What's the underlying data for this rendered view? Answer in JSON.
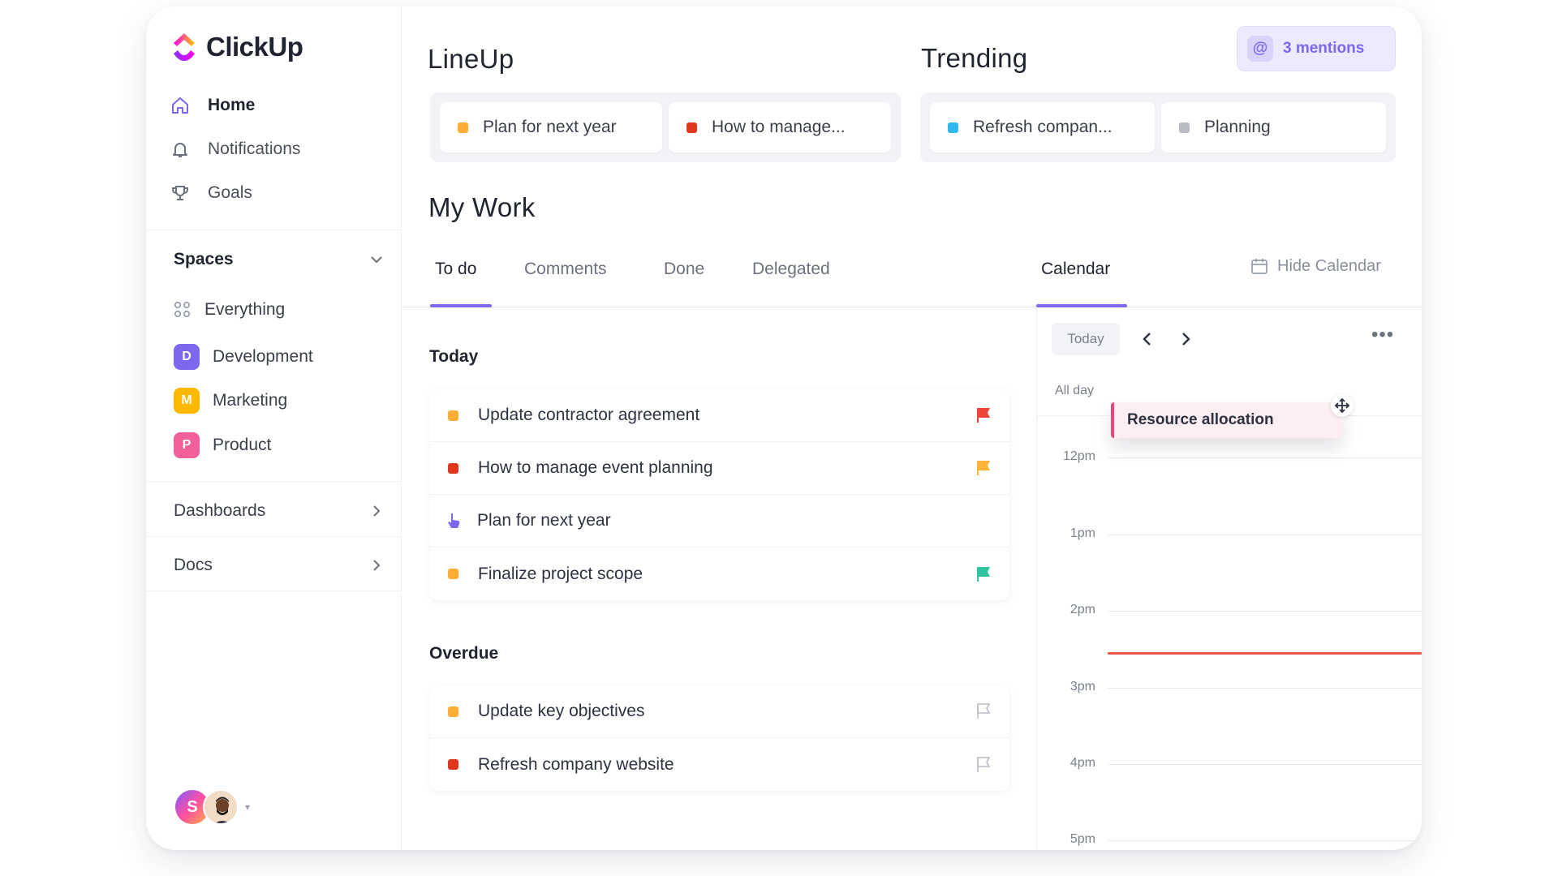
{
  "brand": {
    "name": "ClickUp"
  },
  "sidebar": {
    "nav": [
      {
        "label": "Home",
        "icon": "home-icon"
      },
      {
        "label": "Notifications",
        "icon": "bell-icon"
      },
      {
        "label": "Goals",
        "icon": "trophy-icon"
      }
    ],
    "spaces_title": "Spaces",
    "everything_label": "Everything",
    "spaces": [
      {
        "letter": "D",
        "label": "Development",
        "color": "#7b68ee"
      },
      {
        "letter": "M",
        "label": "Marketing",
        "color": "#ffb800"
      },
      {
        "letter": "P",
        "label": "Product",
        "color": "#f25f9a"
      }
    ],
    "dashboards_label": "Dashboards",
    "docs_label": "Docs",
    "avatar_letter": "S"
  },
  "lineup": {
    "title": "LineUp",
    "items": [
      {
        "label": "Plan for next year",
        "color": "#ffae35"
      },
      {
        "label": "How to manage...",
        "color": "#e0371f"
      }
    ]
  },
  "trending": {
    "title": "Trending",
    "items": [
      {
        "label": "Refresh compan...",
        "color": "#2eb9f0"
      },
      {
        "label": "Planning",
        "color": "#b9bcc3"
      }
    ]
  },
  "mentions": {
    "label": "3 mentions"
  },
  "my_work": {
    "title": "My Work",
    "tabs": [
      "To do",
      "Comments",
      "Done",
      "Delegated"
    ],
    "calendar_tab": "Calendar",
    "hide_calendar": "Hide Calendar",
    "today_label": "Today",
    "today_tasks": [
      {
        "title": "Update contractor agreement",
        "color": "#ffae35",
        "flag": "#f0453a"
      },
      {
        "title": "How to manage event planning",
        "color": "#e0371f",
        "flag": "#ffb33a"
      },
      {
        "title": "Plan for next year",
        "color": "#7b68ee",
        "flag": ""
      },
      {
        "title": "Finalize project scope",
        "color": "#ffae35",
        "flag": "#2ec4a0"
      }
    ],
    "overdue_label": "Overdue",
    "overdue_tasks": [
      {
        "title": "Update key objectives",
        "color": "#ffae35",
        "flag": "outline"
      },
      {
        "title": "Refresh company website",
        "color": "#e0371f",
        "flag": "outline"
      }
    ]
  },
  "calendar": {
    "today_button": "Today",
    "all_day": "All day",
    "event": "Resource allocation",
    "hours": [
      "12pm",
      "1pm",
      "2pm",
      "3pm",
      "4pm",
      "5pm"
    ]
  }
}
